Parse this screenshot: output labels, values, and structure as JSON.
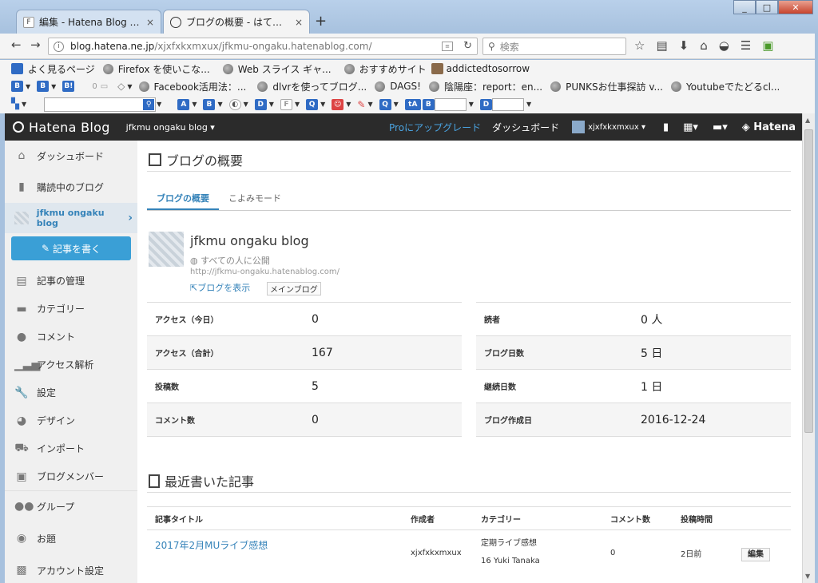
{
  "tabs": [
    {
      "label": "編集 - Hatena Blog - xj...",
      "close": "×",
      "active": false
    },
    {
      "label": "ブログの概要 - はてなブ...",
      "close": "×",
      "active": true
    }
  ],
  "newtab": "+",
  "urlbar": {
    "host": "blog.hatena.ne.jp",
    "path": "/xjxfxkxmxux/jfkmu-ongaku.hatenablog.com/"
  },
  "search": {
    "placeholder": "検索"
  },
  "bookmarks1": [
    "よく見るページ",
    "Firefox を使いこな...",
    "Web スライス ギャ...",
    "おすすめサイト",
    "addictedtosorrow"
  ],
  "bookmarks2": {
    "count": "0",
    "items": [
      "Facebook活用法：...",
      "dlvrを使ってブログ...",
      "DAGS!",
      "陰陽座：report：en...",
      "PUNKSお仕事探訪 v...",
      "Youtubeでたどるcl..."
    ]
  },
  "hatena": {
    "logo": "Hatena Blog",
    "blog_selector": "jfkmu ongaku blog ▾",
    "pro": "Proにアップグレード",
    "dashboard": "ダッシュボード",
    "user": "xjxfxkxmxux ▾",
    "brand": "Hatena"
  },
  "sidebar": {
    "items_top": [
      {
        "label": "ダッシュボード",
        "icon": "home-icon"
      },
      {
        "label": "購読中のブログ",
        "icon": "bookmark-icon"
      }
    ],
    "blog": "jfkmu ongaku blog",
    "write": "記事を書く",
    "items": [
      {
        "label": "記事の管理",
        "icon": "document-icon"
      },
      {
        "label": "カテゴリー",
        "icon": "folder-icon"
      },
      {
        "label": "コメント",
        "icon": "comment-icon"
      },
      {
        "label": "アクセス解析",
        "icon": "analytics-icon"
      },
      {
        "label": "設定",
        "icon": "wrench-icon"
      },
      {
        "label": "デザイン",
        "icon": "palette-icon"
      },
      {
        "label": "インポート",
        "icon": "import-icon"
      },
      {
        "label": "ブログメンバー",
        "icon": "members-icon"
      },
      {
        "label": "グループ",
        "icon": "group-icon"
      },
      {
        "label": "お題",
        "icon": "topic-icon"
      },
      {
        "label": "アカウント設定",
        "icon": "account-icon"
      }
    ]
  },
  "main": {
    "title": "ブログの概要",
    "tabs": [
      "ブログの概要",
      "こよみモード"
    ],
    "blog_name": "jfkmu ongaku blog",
    "visibility": "すべての人に公開",
    "blog_url": "http://jfkmu-ongaku.hatenablog.com/",
    "view_blog": "ブログを表示",
    "main_blog": "メインブログ",
    "stats_left": [
      {
        "label": "アクセス（今日）",
        "value": "0"
      },
      {
        "label": "アクセス（合計）",
        "value": "167"
      },
      {
        "label": "投稿数",
        "value": "5"
      },
      {
        "label": "コメント数",
        "value": "0"
      }
    ],
    "stats_right": [
      {
        "label": "読者",
        "value": "0 人"
      },
      {
        "label": "ブログ日数",
        "value": "5 日"
      },
      {
        "label": "継続日数",
        "value": "1 日"
      },
      {
        "label": "ブログ作成日",
        "value": "2016-12-24"
      }
    ],
    "recent_title": "最近書いた記事",
    "recent_headers": [
      "記事タイトル",
      "作成者",
      "カテゴリー",
      "コメント数",
      "投稿時間"
    ],
    "recent_rows": [
      {
        "title": "2017年2月MUライブ感想",
        "author": "xjxfxkxmxux",
        "categories": [
          "定期ライブ感想",
          "16 Yuki Tanaka"
        ],
        "comments": "0",
        "time": "2日前",
        "edit": "編集"
      }
    ]
  }
}
